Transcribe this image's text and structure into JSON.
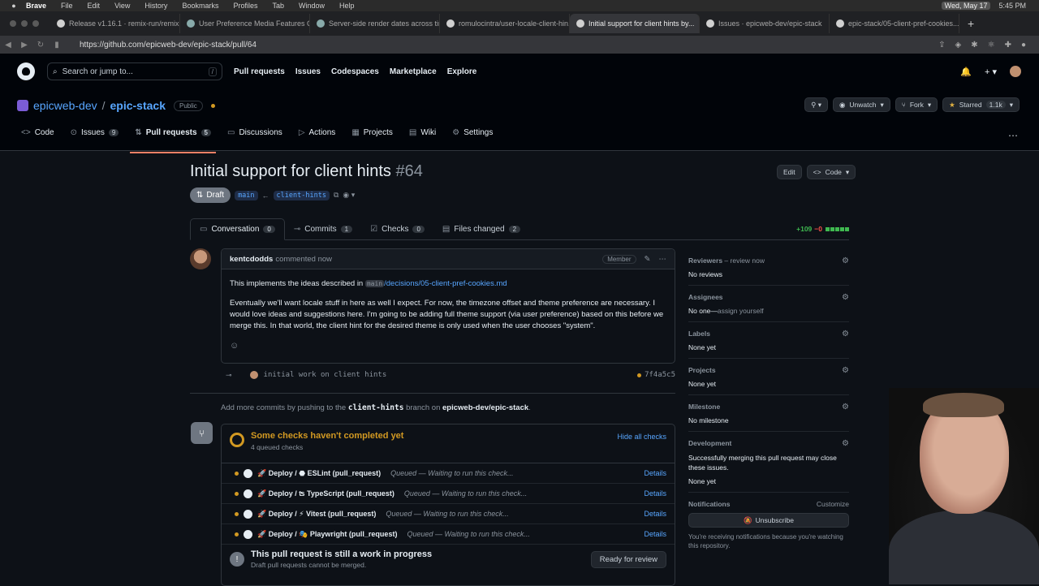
{
  "menubar": {
    "app": "Brave",
    "items": [
      "File",
      "Edit",
      "View",
      "History",
      "Bookmarks",
      "Profiles",
      "Tab",
      "Window",
      "Help"
    ],
    "date": "Wed, May 17",
    "time": "5:45 PM"
  },
  "tabs": [
    {
      "label": "Release v1.16.1 · remix-run/remix"
    },
    {
      "label": "User Preference Media Features Cli..."
    },
    {
      "label": "Server-side render dates across tim..."
    },
    {
      "label": "romulocintra/user-locale-client-hin..."
    },
    {
      "label": "Initial support for client hints by..."
    },
    {
      "label": "Issues · epicweb-dev/epic-stack"
    },
    {
      "label": "epic-stack/05-client-pref-cookies..."
    }
  ],
  "address": {
    "url": "https://github.com/epicweb-dev/epic-stack/pull/64"
  },
  "gh_header": {
    "search_placeholder": "Search or jump to...",
    "slash": "/",
    "nav": [
      "Pull requests",
      "Issues",
      "Codespaces",
      "Marketplace",
      "Explore"
    ]
  },
  "repo": {
    "owner": "epicweb-dev",
    "separator": "/",
    "name": "epic-stack",
    "visibility": "Public",
    "unwatch": "Unwatch",
    "fork": "Fork",
    "starred": "Starred",
    "stars": "1.1k",
    "nav": [
      {
        "label": "Code",
        "count": ""
      },
      {
        "label": "Issues",
        "count": "9"
      },
      {
        "label": "Pull requests",
        "count": "5"
      },
      {
        "label": "Discussions",
        "count": ""
      },
      {
        "label": "Actions",
        "count": ""
      },
      {
        "label": "Projects",
        "count": ""
      },
      {
        "label": "Wiki",
        "count": ""
      },
      {
        "label": "Settings",
        "count": ""
      }
    ]
  },
  "pr": {
    "title": "Initial support for client hints",
    "number": "#64",
    "edit": "Edit",
    "code": "Code",
    "state": "Draft",
    "base": "main",
    "head": "client-hints",
    "tabs": [
      {
        "label": "Conversation",
        "count": "0"
      },
      {
        "label": "Commits",
        "count": "1"
      },
      {
        "label": "Checks",
        "count": "0"
      },
      {
        "label": "Files changed",
        "count": "2"
      }
    ],
    "additions": "+109",
    "deletions": "−0"
  },
  "comment": {
    "author": "kentcdodds",
    "action": "commented now",
    "role": "Member",
    "p1_prefix": "This implements the ideas described in",
    "p1_code": "main",
    "p1_link": "/decisions/05-client-pref-cookies.md",
    "p2": "Eventually we'll want locale stuff in here as well I expect. For now, the timezone offset and theme preference are necessary. I would love ideas and suggestions here. I'm going to be adding full theme support (via user preference) based on this before we merge this. In that world, the client hint for the desired theme is only used when the user chooses \"system\"."
  },
  "commit": {
    "message": "initial work on client hints",
    "sha": "7f4a5c5"
  },
  "addmore": {
    "prefix": "Add more commits by pushing to the",
    "branch": "client-hints",
    "mid": "branch on",
    "repo": "epicweb-dev/epic-stack",
    "suffix": "."
  },
  "checks": {
    "title": "Some checks haven't completed yet",
    "subtitle": "4 queued checks",
    "hide_all": "Hide all checks",
    "rows": [
      {
        "name": "🚀 Deploy / ⬣ ESLint (pull_request)",
        "status": "Queued — Waiting to run this check...",
        "details": "Details"
      },
      {
        "name": "🚀 Deploy / ʦ TypeScript (pull_request)",
        "status": "Queued — Waiting to run this check...",
        "details": "Details"
      },
      {
        "name": "🚀 Deploy / ⚡ Vitest (pull_request)",
        "status": "Queued — Waiting to run this check...",
        "details": "Details"
      },
      {
        "name": "🚀 Deploy / 🎭 Playwright (pull_request)",
        "status": "Queued — Waiting to run this check...",
        "details": "Details"
      }
    ],
    "wip_title": "This pull request is still a work in progress",
    "wip_sub": "Draft pull requests cannot be merged.",
    "ready": "Ready for review"
  },
  "sidebar": {
    "reviewers_title": "Reviewers",
    "reviewers_action": " – review now",
    "reviewers_val": "No reviews",
    "assignees_title": "Assignees",
    "assignees_val": "No one—",
    "assignees_link": "assign yourself",
    "labels_title": "Labels",
    "labels_val": "None yet",
    "projects_title": "Projects",
    "projects_val": "None yet",
    "milestone_title": "Milestone",
    "milestone_val": "No milestone",
    "development_title": "Development",
    "development_note": "Successfully merging this pull request may close these issues.",
    "development_val": "None yet",
    "notifications_title": "Notifications",
    "customize": "Customize",
    "unsubscribe": "Unsubscribe",
    "foot": "You're receiving notifications because you're watching this repository."
  },
  "colors": {
    "bg": "#0d1117",
    "link": "#58a6ff",
    "pending": "#d29922",
    "add": "#3fb950",
    "active_tab": "#f78166"
  }
}
